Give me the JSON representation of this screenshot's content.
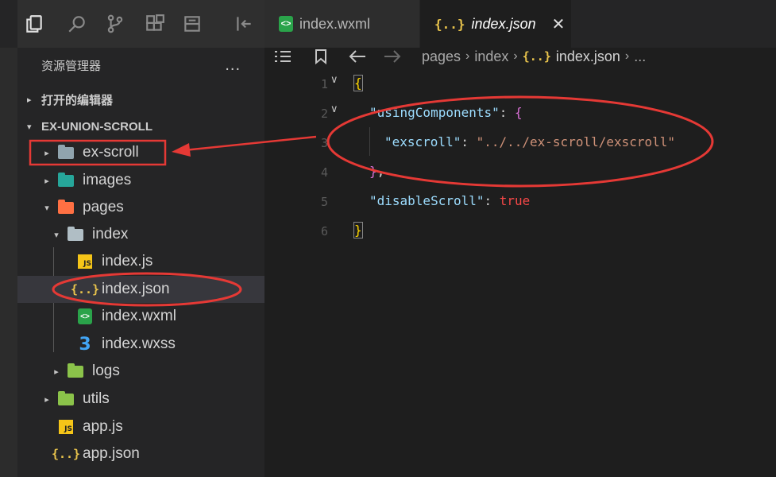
{
  "explorer": {
    "title": "资源管理器",
    "more": "...",
    "open_editors": "打开的编辑器",
    "workspace": "EX-UNION-SCROLL",
    "tree": [
      {
        "label": "ex-scroll",
        "icon": "folder-icon"
      },
      {
        "label": "images",
        "icon": "images-folder-icon"
      },
      {
        "label": "pages",
        "icon": "pages-folder-icon"
      },
      {
        "label": "index",
        "icon": "open-folder-icon"
      },
      {
        "label": "index.js",
        "icon": "js-file-icon"
      },
      {
        "label": "index.json",
        "icon": "json-file-icon"
      },
      {
        "label": "index.wxml",
        "icon": "wxml-file-icon"
      },
      {
        "label": "index.wxss",
        "icon": "css-file-icon"
      },
      {
        "label": "logs",
        "icon": "logs-folder-icon"
      },
      {
        "label": "utils",
        "icon": "utils-folder-icon"
      },
      {
        "label": "app.js",
        "icon": "js-file-icon"
      },
      {
        "label": "app.json",
        "icon": "json-file-icon"
      }
    ]
  },
  "tabs": [
    {
      "label": "index.wxml",
      "active": false
    },
    {
      "label": "index.json",
      "active": true,
      "close": "✕"
    }
  ],
  "breadcrumb": {
    "parts": [
      "pages",
      "index",
      "index.json"
    ],
    "ellipsis": "..."
  },
  "editor": {
    "line_numbers": [
      "1",
      "2",
      "3",
      "4",
      "5",
      "6"
    ],
    "code": {
      "l1_open": "{",
      "l2_key": "\"usingComponents\"",
      "l2_colon": ": ",
      "l2_brace": "{",
      "l3_key": "\"exscroll\"",
      "l3_colon": ": ",
      "l3_value": "\"../../ex-scroll/exscroll\"",
      "l4_brace": "}",
      "l4_comma": ",",
      "l5_key": "\"disableScroll\"",
      "l5_colon": ": ",
      "l5_value": "true",
      "l6_close": "}"
    }
  },
  "glyphs": {
    "json": "{..}",
    "js": "JS",
    "wxml": "<>",
    "css": "3",
    "caret_right": "▸",
    "caret_down": "▾",
    "fold_down": "∨",
    "chevron": "›"
  },
  "colors": {
    "annotation_red": "#e53935",
    "json_yellow": "#e8c34c",
    "string": "#ce9178",
    "key": "#9cdcfe",
    "boolean": "#f44747"
  }
}
